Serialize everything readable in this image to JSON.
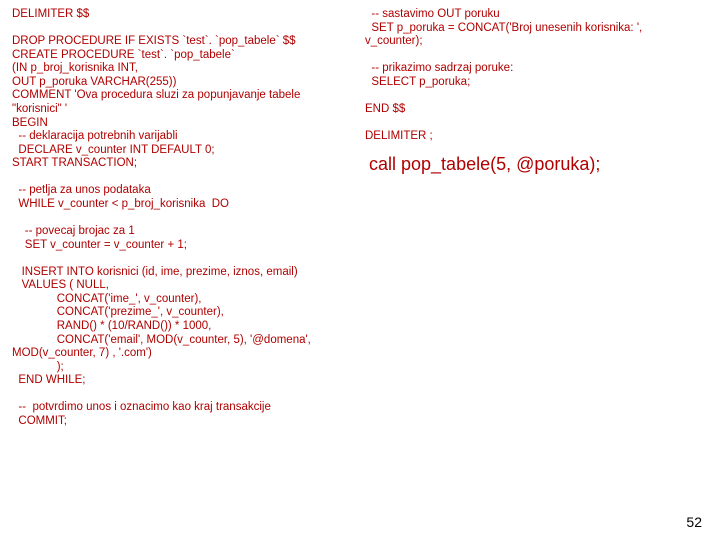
{
  "left": {
    "block1": "DELIMITER $$\n\nDROP PROCEDURE IF EXISTS `test`. `pop_tabele` $$\nCREATE PROCEDURE `test`. `pop_tabele`\n(IN p_broj_korisnika INT,\nOUT p_poruka VARCHAR(255))\nCOMMENT 'Ova procedura sluzi za popunjavanje tabele \n\"korisnici\" '\nBEGIN\n  -- deklaracija potrebnih varijabli\n  DECLARE v_counter INT DEFAULT 0;\nSTART TRANSACTION;\n\n  -- petlja za unos podataka\n  WHILE v_counter < p_broj_korisnika  DO\n\n    -- povecaj brojac za 1\n    SET v_counter = v_counter + 1;\n\n   INSERT INTO korisnici (id, ime, prezime, iznos, email) \n   VALUES ( NULL,\n              CONCAT('ime_', v_counter),\n              CONCAT('prezime_', v_counter),\n              RAND() * (10/RAND()) * 1000,\n              CONCAT('email', MOD(v_counter, 5), '@domena', \nMOD(v_counter, 7) , '.com')\n              );\n  END WHILE;\n\n  --  potvrdimo unos i oznacimo kao kraj transakcije\n  COMMIT;"
  },
  "right": {
    "block1": "  -- sastavimo OUT poruku\n  SET p_poruka = CONCAT('Broj unesenih korisnika: ',  \nv_counter);\n\n  -- prikazimo sadrzaj poruke:\n  SELECT p_poruka;\n\nEND $$\n\nDELIMITER ;",
    "call": "call pop_tabele(5, @poruka);"
  },
  "page_number": "52"
}
